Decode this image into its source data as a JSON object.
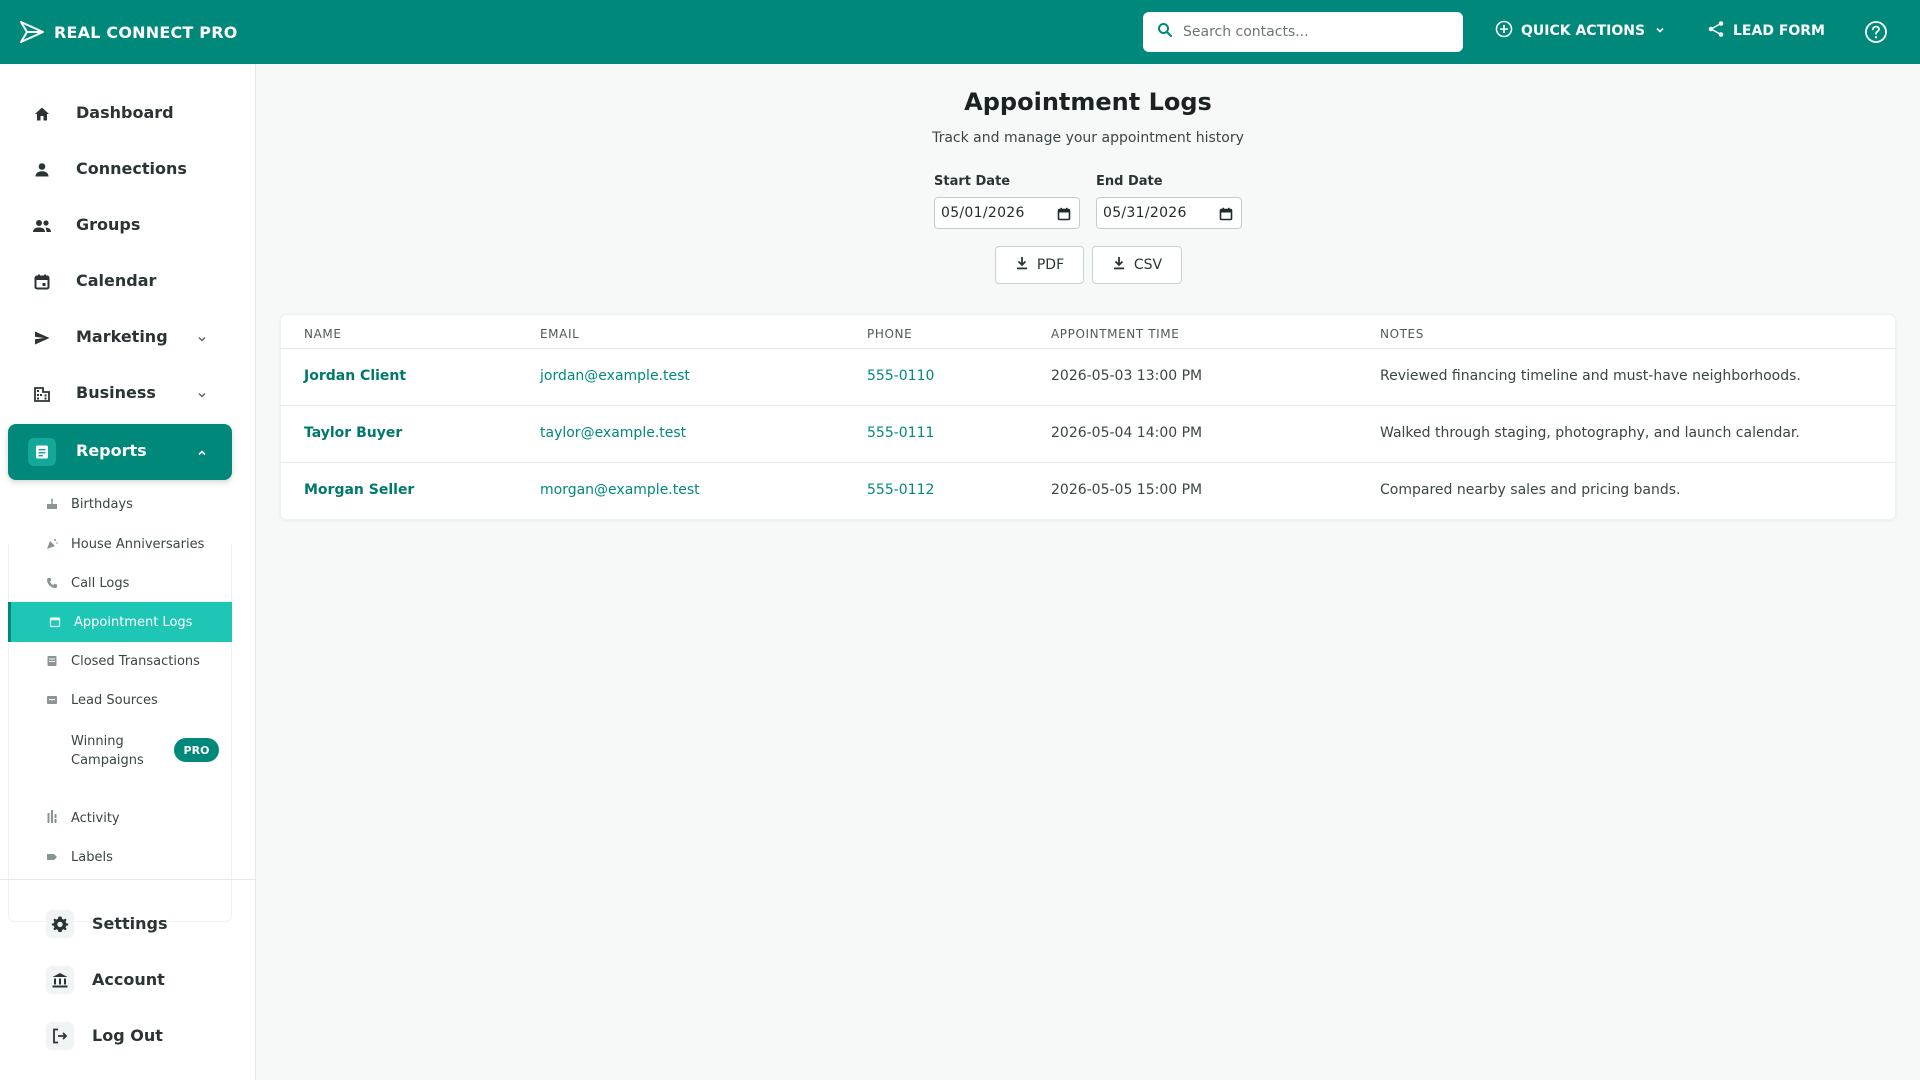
{
  "app": {
    "name": "REAL CONNECT PRO",
    "brand_color": "#00897b"
  },
  "header": {
    "search_placeholder": "Search contacts...",
    "quick_actions_label": "QUICK ACTIONS",
    "lead_form_label": "LEAD FORM"
  },
  "sidebar": {
    "items": [
      {
        "label": "Dashboard",
        "icon": "home-icon"
      },
      {
        "label": "Connections",
        "icon": "person-icon"
      },
      {
        "label": "Groups",
        "icon": "group-icon"
      },
      {
        "label": "Calendar",
        "icon": "calendar-icon"
      },
      {
        "label": "Marketing",
        "icon": "send-icon"
      },
      {
        "label": "Business",
        "icon": "building-icon"
      },
      {
        "label": "Reports",
        "icon": "report-icon"
      }
    ],
    "report_items": [
      {
        "label": "Birthdays",
        "icon": "cake-icon"
      },
      {
        "label": "House Anniversaries",
        "icon": "celebration-icon"
      },
      {
        "label": "Call Logs",
        "icon": "phone-icon"
      },
      {
        "label": "Appointment Logs",
        "icon": "calendar-icon"
      },
      {
        "label": "Closed Transactions",
        "icon": "receipt-icon"
      },
      {
        "label": "Lead Sources",
        "icon": "inbox-icon"
      },
      {
        "label": "Winning Campaigns",
        "icon": "bar-chart-icon"
      },
      {
        "label": "Activity",
        "icon": "bar-chart-icon"
      },
      {
        "label": "Labels",
        "icon": "label-icon"
      }
    ],
    "pro_badge": "PRO",
    "bottom_items": [
      {
        "label": "Settings",
        "icon": "gear-icon"
      },
      {
        "label": "Account",
        "icon": "bank-icon"
      },
      {
        "label": "Log Out",
        "icon": "logout-icon"
      }
    ]
  },
  "page": {
    "title": "Appointment Logs",
    "subtitle": "Track and manage your appointment history",
    "start_date_label": "Start Date",
    "start_date_value": "05/01/2026",
    "end_date_label": "End Date",
    "end_date_value": "05/31/2026",
    "pdf_label": "PDF",
    "csv_label": "CSV"
  },
  "table": {
    "columns": [
      "NAME",
      "EMAIL",
      "PHONE",
      "APPOINTMENT TIME",
      "NOTES"
    ],
    "rows": [
      {
        "name": "Jordan Client",
        "email": "jordan@example.test",
        "phone": "555-0110",
        "time": "2026-05-03 13:00 PM",
        "notes": "Reviewed financing timeline and must-have neighborhoods."
      },
      {
        "name": "Taylor Buyer",
        "email": "taylor@example.test",
        "phone": "555-0111",
        "time": "2026-05-04 14:00 PM",
        "notes": "Walked through staging, photography, and launch calendar."
      },
      {
        "name": "Morgan Seller",
        "email": "morgan@example.test",
        "phone": "555-0112",
        "time": "2026-05-05 15:00 PM",
        "notes": "Compared nearby sales and pricing bands."
      }
    ]
  }
}
